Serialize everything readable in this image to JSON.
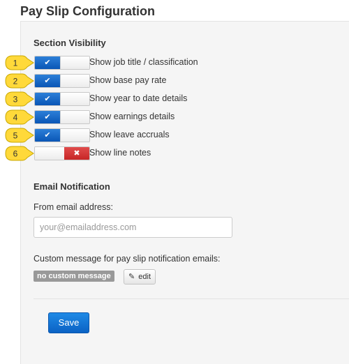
{
  "page": {
    "title": "Pay Slip Configuration"
  },
  "section_visibility": {
    "heading": "Section Visibility",
    "toggles": [
      {
        "num": "1",
        "label": "Show job title / classification",
        "on": true,
        "icon": "check-icon",
        "glyph": "✔"
      },
      {
        "num": "2",
        "label": "Show base pay rate",
        "on": true,
        "icon": "check-icon",
        "glyph": "✔"
      },
      {
        "num": "3",
        "label": "Show year to date details",
        "on": true,
        "icon": "check-icon",
        "glyph": "✔"
      },
      {
        "num": "4",
        "label": "Show earnings details",
        "on": true,
        "icon": "check-icon",
        "glyph": "✔"
      },
      {
        "num": "5",
        "label": "Show leave accruals",
        "on": true,
        "icon": "check-icon",
        "glyph": "✔"
      },
      {
        "num": "6",
        "label": "Show line notes",
        "on": false,
        "icon": "x-icon",
        "glyph": "✖"
      }
    ]
  },
  "email_notification": {
    "heading": "Email Notification",
    "from_label": "From email address:",
    "from_value": "",
    "from_placeholder": "your@emailaddress.com",
    "custom_message_label": "Custom message for pay slip notification emails:",
    "custom_message_badge": "no custom message",
    "edit_label": "edit",
    "edit_icon": "pencil-icon",
    "edit_glyph": "✎"
  },
  "actions": {
    "save_label": "Save"
  },
  "colors": {
    "toggle_on": "#0a56b6",
    "toggle_off": "#c72626",
    "callout_fill": "#ffd93a",
    "save_button": "#0b62c4",
    "badge": "#999999"
  }
}
